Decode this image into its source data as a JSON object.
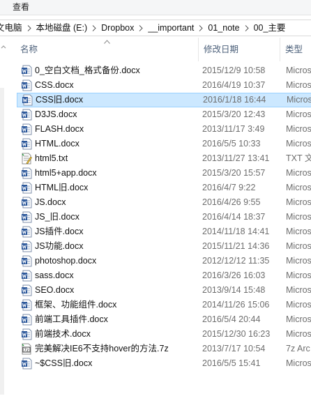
{
  "ribbon": {
    "tab_view": "查看"
  },
  "breadcrumb": [
    "文电脑",
    "本地磁盘 (E:)",
    "Dropbox",
    "__important",
    "01_note",
    "00_主要"
  ],
  "columns": {
    "name": "名称",
    "date": "修改日期",
    "type": "类型"
  },
  "files": [
    {
      "name": "0_空白文档_格式备份.docx",
      "date": "2015/12/9 10:58",
      "type": "Micros",
      "icon": "word-doc-icon",
      "selected": false
    },
    {
      "name": "CSS.docx",
      "date": "2016/4/19 10:37",
      "type": "Micros",
      "icon": "word-doc-icon",
      "selected": false
    },
    {
      "name": "CSS旧.docx",
      "date": "2016/1/18 16:44",
      "type": "Micros",
      "icon": "word-doc-icon",
      "selected": true
    },
    {
      "name": "D3JS.docx",
      "date": "2015/3/20 12:43",
      "type": "Micros",
      "icon": "word-doc-icon",
      "selected": false
    },
    {
      "name": "FLASH.docx",
      "date": "2013/11/17 3:49",
      "type": "Micros",
      "icon": "word-doc-icon",
      "selected": false
    },
    {
      "name": "HTML.docx",
      "date": "2016/5/5 10:33",
      "type": "Micros",
      "icon": "word-doc-icon",
      "selected": false
    },
    {
      "name": "html5.txt",
      "date": "2013/11/27 13:41",
      "type": "TXT 文",
      "icon": "text-file-icon",
      "selected": false
    },
    {
      "name": "html5+app.docx",
      "date": "2015/3/20 15:57",
      "type": "Micros",
      "icon": "word-doc-icon",
      "selected": false
    },
    {
      "name": "HTML旧.docx",
      "date": "2016/4/7 9:22",
      "type": "Micros",
      "icon": "word-doc-icon",
      "selected": false
    },
    {
      "name": "JS.docx",
      "date": "2016/4/26 9:55",
      "type": "Micros",
      "icon": "word-doc-icon",
      "selected": false
    },
    {
      "name": "JS_旧.docx",
      "date": "2016/4/14 18:37",
      "type": "Micros",
      "icon": "word-doc-icon",
      "selected": false
    },
    {
      "name": "JS插件.docx",
      "date": "2014/11/18 14:41",
      "type": "Micros",
      "icon": "word-doc-icon",
      "selected": false
    },
    {
      "name": "JS功能.docx",
      "date": "2015/11/21 14:36",
      "type": "Micros",
      "icon": "word-doc-icon",
      "selected": false
    },
    {
      "name": "photoshop.docx",
      "date": "2012/12/12 11:35",
      "type": "Micros",
      "icon": "word-doc-icon",
      "selected": false
    },
    {
      "name": "sass.docx",
      "date": "2016/3/26 16:03",
      "type": "Micros",
      "icon": "word-doc-icon",
      "selected": false
    },
    {
      "name": "SEO.docx",
      "date": "2013/9/14 15:48",
      "type": "Micros",
      "icon": "word-doc-icon",
      "selected": false
    },
    {
      "name": "框架、功能组件.docx",
      "date": "2014/11/26 15:06",
      "type": "Micros",
      "icon": "word-doc-icon",
      "selected": false
    },
    {
      "name": "前端工具插件.docx",
      "date": "2016/5/4 20:44",
      "type": "Micros",
      "icon": "word-doc-icon",
      "selected": false
    },
    {
      "name": "前端技术.docx",
      "date": "2015/12/30 16:23",
      "type": "Micros",
      "icon": "word-doc-icon",
      "selected": false
    },
    {
      "name": "完美解决IE6不支持hover的方法.7z",
      "date": "2013/7/17 10:54",
      "type": "7z Arc",
      "icon": "archive-7z-icon",
      "selected": false
    },
    {
      "name": "~$CSS旧.docx",
      "date": "2016/5/5 15:41",
      "type": "Micros",
      "icon": "word-doc-icon",
      "selected": false
    }
  ],
  "colors": {
    "selection_bg": "#cce8ff",
    "selection_border": "#99d1ff",
    "header_text": "#4c607a",
    "secondary_text": "#6d6d6d",
    "word_blue": "#2b579a"
  }
}
